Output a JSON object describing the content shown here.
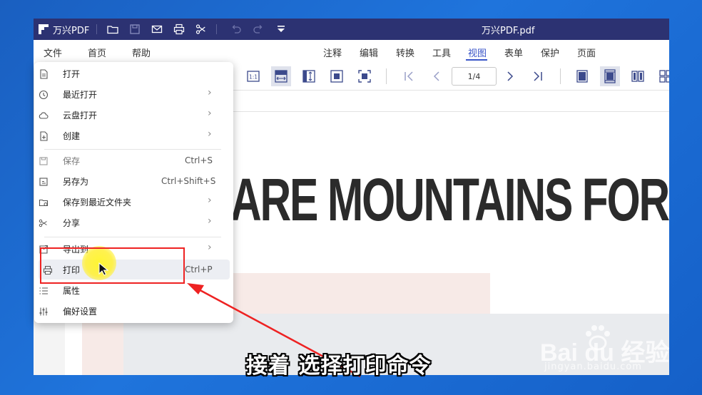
{
  "titlebar": {
    "app_name": "万兴PDF",
    "file_name": "万兴PDF.pdf",
    "icons": [
      "app-logo-icon",
      "folder-icon",
      "save-icon",
      "mail-icon",
      "print-icon",
      "share-icon",
      "undo-icon",
      "redo-icon",
      "quick-access-dropdown-icon"
    ]
  },
  "menubar": {
    "left": [
      "文件",
      "首页",
      "帮助"
    ],
    "right": [
      "注释",
      "编辑",
      "转换",
      "工具",
      "视图",
      "表单",
      "保护",
      "页面"
    ],
    "active": "视图"
  },
  "toolbar": {
    "page_indicator": "1/4",
    "icons": [
      "actual-size-icon",
      "fit-width-icon",
      "fit-height-icon",
      "fit-page-icon",
      "full-screen-icon",
      "first-page-icon",
      "prev-page-icon",
      "next-page-icon",
      "last-page-icon",
      "single-page-icon",
      "continuous-page-icon",
      "two-page-icon",
      "grid-view-icon"
    ],
    "actual_size_label": "1:1"
  },
  "document": {
    "heading": "ARE MOUNTAINS FORM"
  },
  "file_menu": {
    "items": [
      {
        "label": "打开",
        "icon": "open-file-icon",
        "shortcut": "",
        "submenu": false
      },
      {
        "label": "最近打开",
        "icon": "recent-clock-icon",
        "shortcut": "",
        "submenu": true
      },
      {
        "label": "云盘打开",
        "icon": "cloud-icon",
        "shortcut": "",
        "submenu": true
      },
      {
        "label": "创建",
        "icon": "create-file-icon",
        "shortcut": "",
        "submenu": true
      },
      {
        "label": "保存",
        "icon": "save-icon",
        "shortcut": "Ctrl+S",
        "submenu": false
      },
      {
        "label": "另存为",
        "icon": "save-as-icon",
        "shortcut": "Ctrl+Shift+S",
        "submenu": false
      },
      {
        "label": "保存到最近文件夹",
        "icon": "save-folder-icon",
        "shortcut": "",
        "submenu": true
      },
      {
        "label": "分享",
        "icon": "share-icon",
        "shortcut": "",
        "submenu": true
      },
      {
        "label": "导出到",
        "icon": "export-icon",
        "shortcut": "",
        "submenu": true
      },
      {
        "label": "打印",
        "icon": "print-icon",
        "shortcut": "Ctrl+P",
        "submenu": false
      },
      {
        "label": "属性",
        "icon": "properties-list-icon",
        "shortcut": "",
        "submenu": false
      },
      {
        "label": "偏好设置",
        "icon": "preferences-sliders-icon",
        "shortcut": "",
        "submenu": false
      }
    ],
    "highlighted": "打印"
  },
  "overlay": {
    "subtitle": "接着 选择打印命令",
    "watermark_logo": "Bai  du 经验",
    "watermark_url": "jingyan.baidu.com",
    "annotation_color": "#ee2222"
  }
}
